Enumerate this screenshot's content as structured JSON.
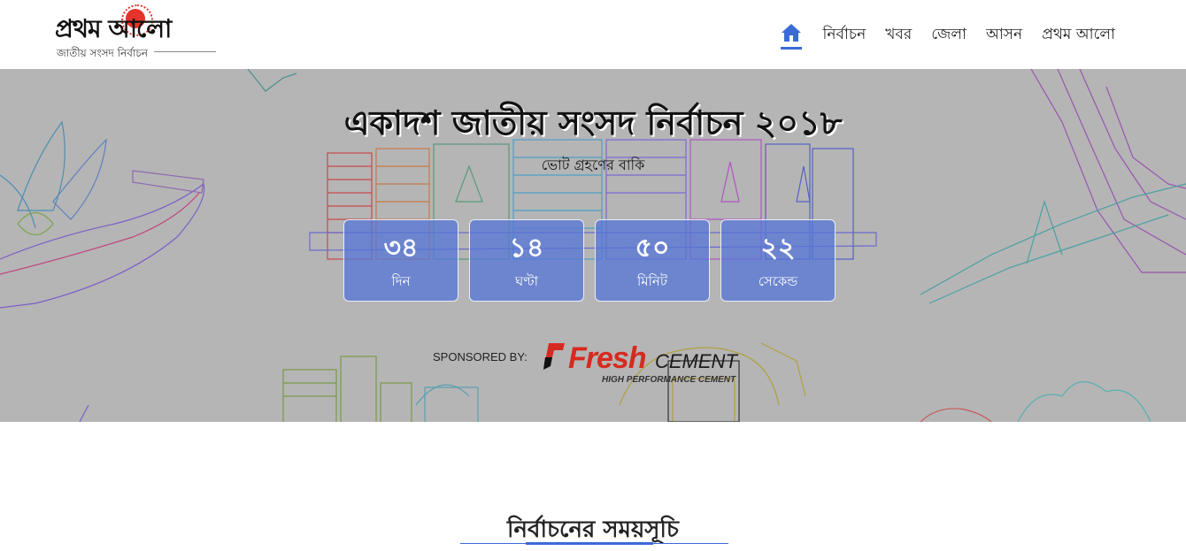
{
  "logo": {
    "title": "প্রথম আলো",
    "subtitle": "জাতীয় সংসদ নির্বাচন",
    "sun_color": "#e5342a"
  },
  "nav": {
    "home_icon": "home-icon",
    "items": [
      {
        "label": "নির্বাচন"
      },
      {
        "label": "খবর"
      },
      {
        "label": "জেলা"
      },
      {
        "label": "আসন"
      },
      {
        "label": "প্রথম আলো"
      }
    ],
    "accent": "#3a6bd6"
  },
  "hero": {
    "title": "একাদশ জাতীয় সংসদ নির্বাচন ২০১৮",
    "subtitle": "ভোট গ্রহণের বাকি",
    "countdown": [
      {
        "value": "৩৪",
        "label": "দিন"
      },
      {
        "value": "১৪",
        "label": "ঘণ্টা"
      },
      {
        "value": "৫০",
        "label": "মিনিট"
      },
      {
        "value": "২২",
        "label": "সেকেন্ড"
      }
    ],
    "sponsor_label": "SPONSORED BY:",
    "sponsor": {
      "name": "Fresh",
      "product": "CEMENT",
      "tagline": "HIGH PERFORMANCE CEMENT"
    }
  },
  "section": {
    "title": "নির্বাচনের সময়সূচি"
  }
}
